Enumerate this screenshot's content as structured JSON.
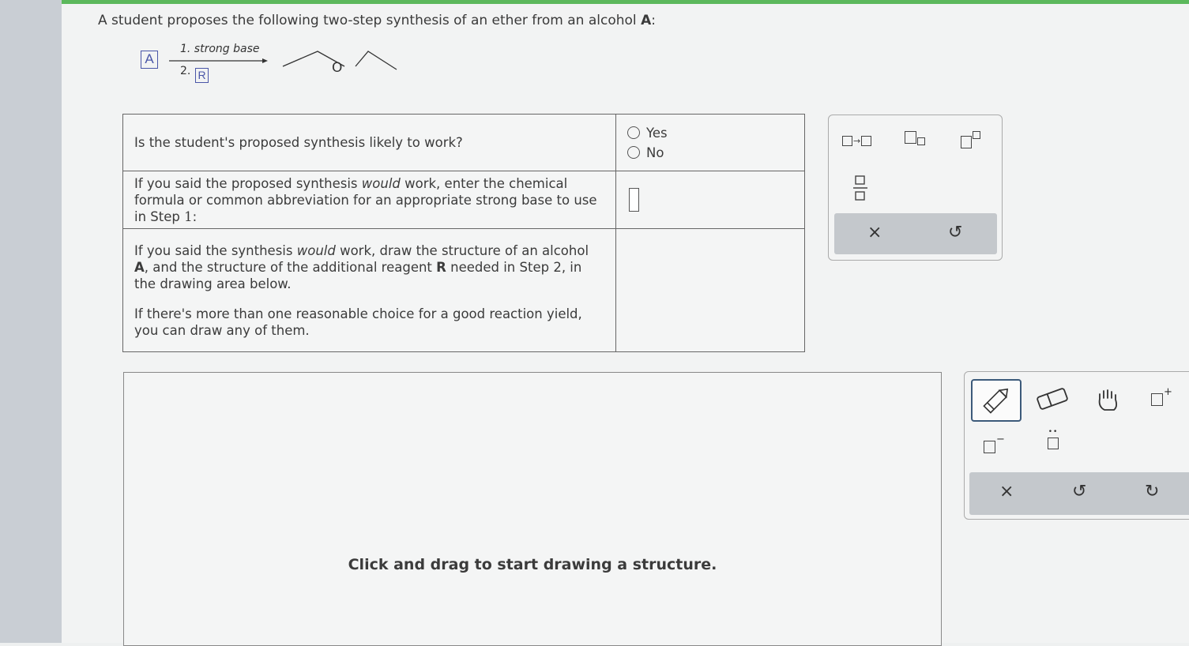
{
  "question": {
    "text": "A student proposes the following two-step synthesis of an ether from an alcohol ",
    "bold": "A",
    "colon": ":"
  },
  "scheme": {
    "reactant_label": "A",
    "step1": "1. strong base",
    "step2": "2.",
    "reagent_label": "R",
    "product_atom": "O"
  },
  "table": {
    "row1": {
      "question": "Is the student's proposed synthesis likely to work?",
      "options": [
        "Yes",
        "No"
      ]
    },
    "row2": {
      "q_part1": "If you said the proposed synthesis ",
      "q_italic": "would",
      "q_part2": " work, enter the chemical formula or common abbreviation for an appropriate strong base to use in Step ",
      "q_num": "1",
      "q_colon": ":"
    },
    "row3": {
      "p1_part1": "If you said the synthesis ",
      "p1_italic": "would",
      "p1_part2": " work, draw the structure of an alcohol ",
      "p1_bold_a": "A",
      "p1_part3": ", and the structure of the additional reagent ",
      "p1_bold_r": "R",
      "p1_part4": " needed in Step 2, in the drawing area below.",
      "p2": "If there's more than one reasonable choice for a good reaction yield, you can draw any of them."
    }
  },
  "palette": {
    "arrow_glyph": "→",
    "clear": "×",
    "undo": "↺"
  },
  "canvas": {
    "hint": "Click and drag to start drawing a structure."
  },
  "tools": {
    "charge_minus": "−",
    "charge_plus": "+",
    "lone_pair": "••",
    "clear": "×",
    "undo": "↺",
    "redo": "↻"
  }
}
